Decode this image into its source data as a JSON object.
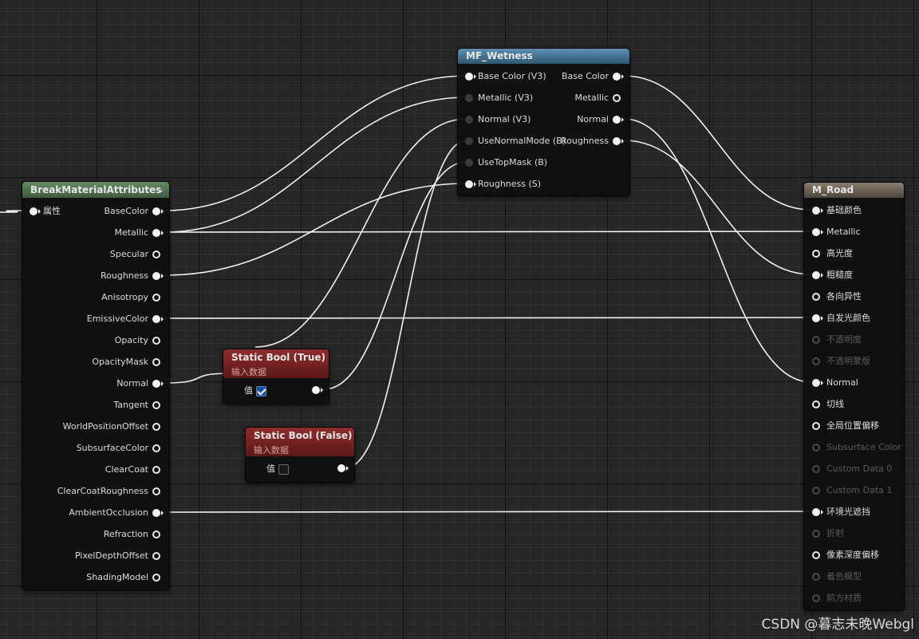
{
  "break_node": {
    "title": "BreakMaterialAttributes",
    "input_label": "属性",
    "outputs": [
      "BaseColor",
      "Metallic",
      "Specular",
      "Roughness",
      "Anisotropy",
      "EmissiveColor",
      "Opacity",
      "OpacityMask",
      "Normal",
      "Tangent",
      "WorldPositionOffset",
      "SubsurfaceColor",
      "ClearCoat",
      "ClearCoatRoughness",
      "AmbientOcclusion",
      "Refraction",
      "PixelDepthOffset",
      "ShadingModel"
    ],
    "header_color": "#4e6b4e"
  },
  "wetness_node": {
    "title": "MF_Wetness",
    "inputs": [
      "Base Color (V3)",
      "Metallic (V3)",
      "Normal (V3)",
      "UseNormalMode (B)",
      "UseTopMask (B)",
      "Roughness (S)"
    ],
    "outputs": [
      "Base Color",
      "Metallic",
      "Normal",
      "Roughness"
    ],
    "header_color": "#3f6c8a"
  },
  "bool_true_node": {
    "title": "Static Bool (True)",
    "subtitle": "输入数据",
    "value_label": "值",
    "checked": true,
    "header_color": "#7a2222"
  },
  "bool_false_node": {
    "title": "Static Bool (False)",
    "subtitle": "输入数据",
    "value_label": "值",
    "checked": false,
    "header_color": "#7a2222"
  },
  "road_node": {
    "title": "M_Road",
    "inputs": [
      "基础颜色",
      "Metallic",
      "高光度",
      "粗糙度",
      "各向异性",
      "自发光颜色",
      "不透明度",
      "不透明蒙版",
      "Normal",
      "切线",
      "全局位置偏移",
      "Subsurface Color",
      "Custom Data 0",
      "Custom Data 1",
      "环境光遮挡",
      "折射",
      "像素深度偏移",
      "着色模型",
      "前方材质"
    ],
    "header_color": "#6e6458"
  },
  "watermark": "CSDN @暮志未晚Webgl"
}
